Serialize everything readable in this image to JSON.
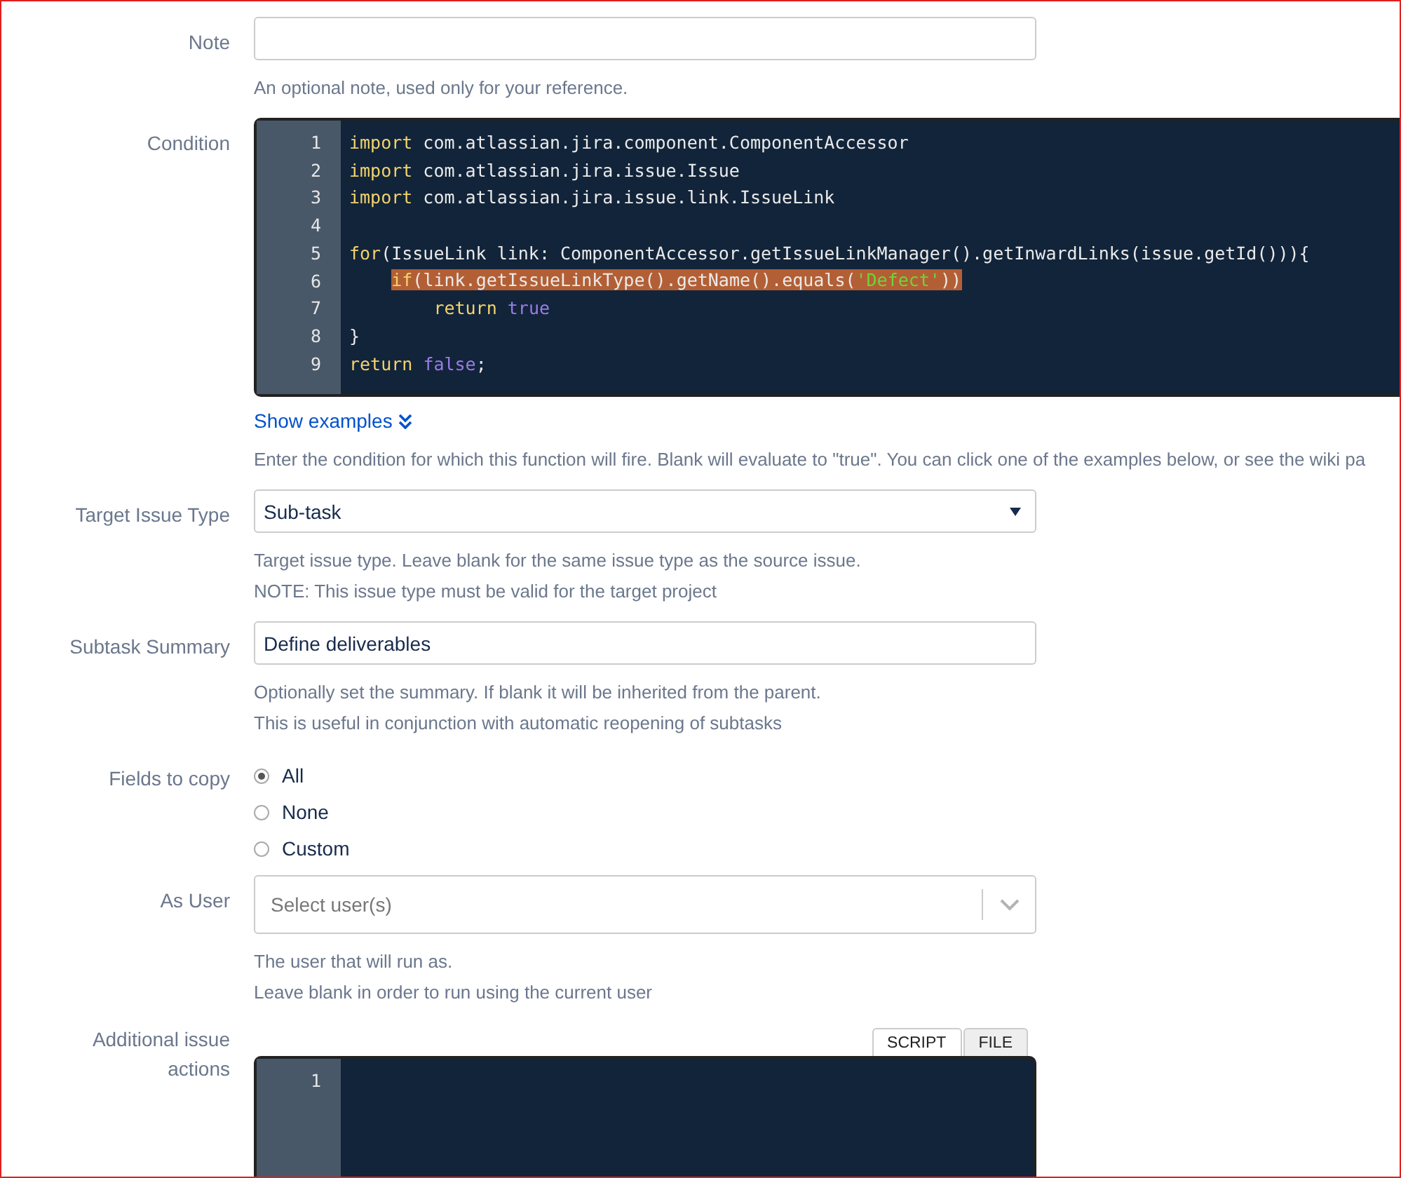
{
  "fields": [
    {
      "kind": "text",
      "label": "Note",
      "help": [
        "An optional note, used only for your reference."
      ]
    },
    {
      "kind": "code",
      "label": "Condition",
      "lines": [
        {
          "number": "1",
          "highlighted": false,
          "tokens": [
            {
              "kind": "keyword",
              "text": "import"
            },
            {
              "kind": "plain",
              "text": " com.atlassian.jira.component.ComponentAccessor"
            }
          ]
        },
        {
          "number": "2",
          "highlighted": false,
          "tokens": [
            {
              "kind": "keyword",
              "text": "import"
            },
            {
              "kind": "plain",
              "text": " com.atlassian.jira.issue.Issue"
            }
          ]
        },
        {
          "number": "3",
          "highlighted": false,
          "tokens": [
            {
              "kind": "keyword",
              "text": "import"
            },
            {
              "kind": "plain",
              "text": " com.atlassian.jira.issue.link.IssueLink"
            }
          ]
        },
        {
          "number": "4",
          "highlighted": false
        },
        {
          "number": "5",
          "highlighted": false,
          "tokens": [
            {
              "kind": "keyword",
              "text": "for"
            },
            {
              "kind": "plain",
              "text": "(IssueLink link: ComponentAccessor.getIssueLinkManager().getInwardLinks(issue.getId())){"
            }
          ]
        },
        {
          "number": "6",
          "highlighted": true,
          "tokens": [
            {
              "kind": "keyword",
              "text": "    if"
            },
            {
              "kind": "plain",
              "text": "(link.getIssueLinkType().getName().equals("
            },
            {
              "kind": "string",
              "text": "'Defect'"
            },
            {
              "kind": "plain",
              "text": "))"
            }
          ]
        },
        {
          "number": "7",
          "highlighted": false,
          "tokens": [
            {
              "kind": "keyword",
              "text": "        return "
            },
            {
              "kind": "literal",
              "text": "true"
            }
          ]
        },
        {
          "number": "8",
          "highlighted": false,
          "tokens": [
            {
              "kind": "plain",
              "text": "}"
            }
          ]
        },
        {
          "number": "9",
          "highlighted": false,
          "tokens": [
            {
              "kind": "keyword",
              "text": "return "
            },
            {
              "kind": "literal",
              "text": "false"
            },
            {
              "kind": "plain",
              "text": ";"
            }
          ]
        }
      ],
      "link": "Show examples",
      "help": [
        "Enter the condition for which this function will fire. Blank will evaluate to \"true\". You can click one of the examples below, or see the wiki pa"
      ]
    },
    {
      "kind": "select",
      "label": "Target Issue Type",
      "value": "Sub-task",
      "help": [
        "Target issue type. Leave blank for the same issue type as the source issue.",
        "NOTE: This issue type must be valid for the target project"
      ]
    },
    {
      "kind": "text",
      "label": "Subtask Summary",
      "value": "Define deliverables",
      "help": [
        "Optionally set the summary. If blank it will be inherited from the parent.",
        "This is useful in conjunction with automatic reopening of subtasks"
      ]
    },
    {
      "kind": "radio",
      "label": "Fields to copy",
      "options": [
        {
          "label": "All",
          "selected": true
        },
        {
          "label": "None",
          "selected": false
        },
        {
          "label": "Custom",
          "selected": false
        }
      ]
    },
    {
      "kind": "user",
      "label": "As User",
      "placeholder": "Select user(s)",
      "help": [
        "The user that will run as.",
        "Leave blank in order to run using the current user"
      ]
    },
    {
      "kind": "script",
      "label": "Additional issue actions",
      "tabs": [
        {
          "label": "SCRIPT",
          "selected": true
        },
        {
          "label": "FILE",
          "selected": false
        }
      ],
      "lines": [
        {
          "number": "1"
        }
      ]
    }
  ]
}
